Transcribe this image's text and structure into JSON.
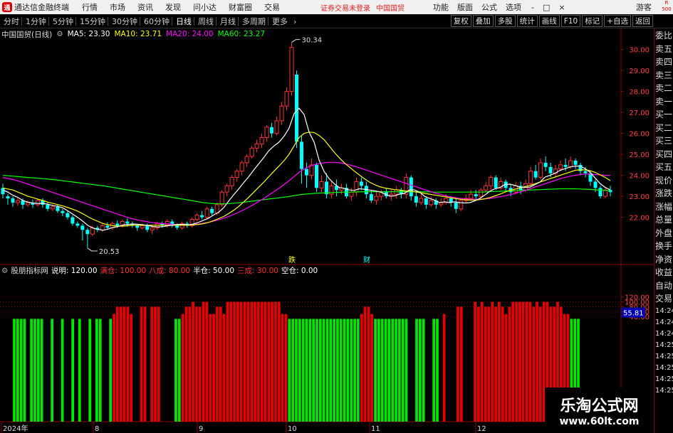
{
  "titlebar": {
    "app_name": "通达信金融终端",
    "menus": [
      "行情",
      "市场",
      "资讯",
      "发现",
      "问小达",
      "财富圈",
      "交易"
    ],
    "alert": "证券交易未登录",
    "stock": "中国国贸",
    "right_menus": [
      "功能",
      "版面",
      "公式",
      "选项"
    ],
    "window_controls": [
      "-",
      "□",
      "×"
    ],
    "user": "游客",
    "badge": "R 500"
  },
  "periodbar": {
    "periods": [
      "分时",
      "1分钟",
      "5分钟",
      "15分钟",
      "30分钟",
      "60分钟",
      "日线",
      "周线",
      "月线",
      "多周期",
      "更多"
    ],
    "active": "日线",
    "tools": [
      "复权",
      "叠加",
      "多股",
      "统计",
      "画线",
      "F10",
      "标记",
      "+自选",
      "返回"
    ]
  },
  "main_chart": {
    "name": "中国国贸(日线)",
    "ma5": "MA5: 23.30",
    "ma10": "MA10: 23.71",
    "ma20": "MA20: 24.00",
    "ma60": "MA60: 23.27",
    "y_labels": [
      "30.00",
      "29.00",
      "28.00",
      "27.00",
      "26.00",
      "25.00",
      "24.00",
      "23.00",
      "22.00"
    ],
    "high_label": "30.34",
    "low_label": "20.53",
    "event_labels": [
      "跌",
      "财"
    ]
  },
  "sub_chart": {
    "name": "股朋指标网",
    "desc_label": "说明: 120.00",
    "full": "满仓: 100.00",
    "eighty": "八成: 80.00",
    "half": "半仓: 50.00",
    "thirty": "三成: 30.00",
    "empty": "空仓: 0.00",
    "y_labels": [
      "120.00",
      "100.00",
      "80.00",
      "60.00",
      "40.00"
    ],
    "current_value": "55.81"
  },
  "x_axis": {
    "labels": [
      "2024年",
      "8",
      "9",
      "10",
      "11",
      "12"
    ]
  },
  "right_panel": {
    "items": [
      "委比",
      "卖五",
      "卖四",
      "卖三",
      "卖二",
      "卖一",
      "买一",
      "买二",
      "买三",
      "买四",
      "买五",
      "现价",
      "涨跌",
      "涨幅",
      "总量",
      "外盘",
      "换手",
      "净资",
      "收益"
    ],
    "auto": "自动",
    "trade": "交易",
    "times": [
      "14:24",
      "14:24",
      "14:24",
      "14:25",
      "14:25",
      "14:25",
      "14:25",
      "14:25"
    ]
  },
  "watermark": {
    "title": "乐淘公式网",
    "url": "www.60lt.com"
  },
  "colors": {
    "up": "#ff3232",
    "down": "#00ffff",
    "ma5": "#ffffff",
    "ma10": "#ffff00",
    "ma20": "#ff00ff",
    "ma60": "#00ff00",
    "bar_red": "#e60000",
    "bar_green": "#00e600"
  },
  "chart_data": {
    "type": "bar",
    "title": "股朋指标网",
    "candles": [
      [
        23.4,
        23.1,
        23.6,
        22.9
      ],
      [
        23.0,
        22.9,
        23.1,
        22.6
      ],
      [
        22.9,
        22.7,
        23.0,
        22.5
      ],
      [
        22.7,
        22.8,
        22.95,
        22.55
      ],
      [
        22.8,
        22.6,
        22.9,
        22.4
      ],
      [
        22.6,
        22.7,
        22.8,
        22.5
      ],
      [
        22.7,
        22.6,
        22.85,
        22.45
      ],
      [
        22.6,
        22.8,
        22.9,
        22.5
      ],
      [
        22.8,
        22.6,
        22.9,
        22.45
      ],
      [
        22.6,
        22.4,
        22.7,
        22.3
      ],
      [
        22.4,
        22.5,
        22.6,
        22.3
      ],
      [
        22.5,
        22.3,
        22.6,
        22.2
      ],
      [
        22.3,
        22.2,
        22.4,
        22.05
      ],
      [
        22.2,
        22.0,
        22.3,
        21.9
      ],
      [
        22.0,
        21.7,
        22.1,
        21.6
      ],
      [
        21.7,
        21.6,
        21.8,
        21.5
      ],
      [
        21.6,
        21.4,
        21.7,
        20.9
      ],
      [
        21.4,
        21.2,
        21.5,
        20.53
      ],
      [
        21.2,
        21.5,
        21.6,
        21.1
      ],
      [
        21.5,
        21.4,
        21.6,
        21.3
      ],
      [
        21.4,
        21.6,
        21.7,
        21.3
      ],
      [
        21.6,
        21.5,
        21.75,
        21.4
      ],
      [
        21.5,
        21.7,
        21.8,
        21.4
      ],
      [
        21.7,
        21.6,
        21.85,
        21.5
      ],
      [
        21.6,
        21.8,
        21.9,
        21.5
      ],
      [
        21.8,
        21.7,
        21.95,
        21.55
      ],
      [
        21.7,
        21.6,
        21.8,
        21.5
      ],
      [
        21.6,
        21.5,
        21.7,
        21.35
      ],
      [
        21.5,
        21.6,
        21.7,
        21.4
      ],
      [
        21.6,
        21.4,
        21.7,
        21.3
      ],
      [
        21.4,
        21.5,
        21.6,
        21.2
      ],
      [
        21.5,
        21.7,
        21.8,
        21.4
      ],
      [
        21.7,
        21.6,
        21.8,
        21.5
      ],
      [
        21.6,
        21.8,
        21.9,
        21.5
      ],
      [
        21.8,
        21.6,
        21.9,
        21.5
      ],
      [
        21.6,
        21.5,
        21.7,
        21.4
      ],
      [
        21.5,
        21.7,
        21.8,
        21.4
      ],
      [
        21.7,
        21.6,
        21.8,
        21.5
      ],
      [
        21.6,
        21.9,
        22.0,
        21.5
      ],
      [
        21.9,
        22.1,
        22.2,
        21.8
      ],
      [
        22.1,
        22.0,
        22.3,
        21.9
      ],
      [
        22.0,
        22.4,
        22.5,
        21.9
      ],
      [
        22.4,
        22.2,
        22.5,
        22.1
      ],
      [
        22.2,
        22.6,
        22.7,
        22.1
      ],
      [
        22.6,
        23.2,
        23.3,
        22.5
      ],
      [
        23.2,
        23.5,
        23.6,
        23.0
      ],
      [
        23.5,
        23.9,
        24.0,
        23.3
      ],
      [
        23.9,
        24.2,
        24.3,
        23.7
      ],
      [
        24.2,
        24.6,
        24.7,
        24.0
      ],
      [
        24.6,
        24.9,
        25.0,
        24.4
      ],
      [
        24.9,
        25.3,
        25.4,
        24.8
      ],
      [
        25.3,
        25.5,
        25.7,
        25.1
      ],
      [
        25.5,
        25.8,
        26.0,
        25.3
      ],
      [
        25.8,
        26.3,
        26.4,
        25.6
      ],
      [
        26.3,
        26.0,
        26.5,
        25.8
      ],
      [
        26.0,
        26.6,
        26.8,
        25.9
      ],
      [
        26.6,
        27.3,
        27.5,
        26.4
      ],
      [
        27.3,
        28.0,
        28.2,
        27.1
      ],
      [
        28.0,
        30.1,
        30.34,
        27.8
      ],
      [
        28.8,
        25.6,
        29.0,
        25.3
      ],
      [
        25.6,
        24.3,
        25.9,
        23.6
      ],
      [
        24.3,
        24.0,
        24.6,
        23.4
      ],
      [
        24.0,
        24.5,
        24.8,
        23.8
      ],
      [
        24.5,
        23.4,
        24.6,
        23.2
      ],
      [
        23.4,
        23.7,
        24.0,
        23.2
      ],
      [
        23.7,
        23.1,
        24.1,
        22.9
      ],
      [
        23.1,
        23.5,
        23.7,
        22.9
      ],
      [
        23.5,
        23.3,
        23.8,
        23.0
      ],
      [
        23.3,
        23.4,
        23.6,
        23.1
      ],
      [
        23.4,
        23.0,
        23.6,
        22.9
      ],
      [
        23.0,
        23.2,
        23.4,
        22.8
      ],
      [
        23.2,
        23.7,
        23.9,
        23.0
      ],
      [
        23.7,
        23.5,
        23.9,
        23.3
      ],
      [
        23.5,
        23.1,
        23.7,
        22.9
      ],
      [
        23.1,
        22.8,
        23.3,
        22.7
      ],
      [
        22.8,
        23.0,
        23.2,
        22.6
      ],
      [
        23.0,
        23.2,
        23.3,
        22.8
      ],
      [
        23.2,
        23.0,
        23.4,
        22.9
      ],
      [
        23.0,
        23.1,
        23.3,
        22.8
      ],
      [
        23.1,
        23.3,
        23.5,
        22.9
      ],
      [
        23.3,
        23.1,
        23.4,
        22.9
      ],
      [
        23.1,
        23.9,
        24.1,
        22.9
      ],
      [
        23.9,
        23.0,
        24.0,
        22.8
      ],
      [
        23.0,
        22.7,
        23.2,
        22.5
      ],
      [
        22.7,
        22.9,
        23.1,
        22.6
      ],
      [
        22.9,
        22.6,
        23.0,
        22.4
      ],
      [
        22.6,
        22.8,
        23.0,
        22.5
      ],
      [
        22.8,
        22.6,
        22.9,
        22.4
      ],
      [
        22.6,
        22.7,
        22.9,
        22.5
      ],
      [
        22.7,
        22.9,
        23.1,
        22.6
      ],
      [
        22.9,
        22.7,
        23.0,
        22.5
      ],
      [
        22.7,
        22.4,
        22.9,
        22.2
      ],
      [
        22.4,
        22.8,
        22.9,
        22.3
      ],
      [
        22.8,
        22.9,
        23.1,
        22.7
      ],
      [
        22.9,
        23.1,
        23.3,
        22.8
      ],
      [
        23.1,
        23.0,
        23.3,
        22.8
      ],
      [
        23.0,
        23.3,
        23.4,
        22.9
      ],
      [
        23.3,
        23.5,
        23.7,
        23.2
      ],
      [
        23.5,
        23.9,
        24.0,
        23.3
      ],
      [
        23.9,
        23.4,
        24.0,
        23.3
      ],
      [
        23.4,
        23.7,
        23.9,
        23.3
      ],
      [
        23.7,
        23.4,
        23.8,
        23.2
      ],
      [
        23.4,
        23.2,
        23.6,
        23.0
      ],
      [
        23.2,
        23.5,
        23.7,
        23.1
      ],
      [
        23.5,
        23.3,
        23.7,
        23.1
      ],
      [
        23.3,
        23.6,
        23.8,
        23.2
      ],
      [
        23.6,
        24.2,
        24.4,
        23.5
      ],
      [
        24.2,
        23.9,
        24.5,
        23.8
      ],
      [
        23.9,
        24.6,
        24.8,
        23.8
      ],
      [
        24.6,
        24.4,
        24.9,
        24.2
      ],
      [
        24.4,
        24.1,
        24.6,
        23.9
      ],
      [
        24.1,
        24.3,
        24.5,
        23.9
      ],
      [
        24.3,
        24.5,
        24.7,
        24.2
      ],
      [
        24.5,
        24.4,
        24.8,
        24.2
      ],
      [
        24.4,
        24.7,
        24.9,
        24.3
      ],
      [
        24.7,
        24.5,
        24.8,
        24.3
      ],
      [
        24.5,
        24.2,
        24.6,
        24.0
      ],
      [
        24.2,
        24.1,
        24.4,
        23.9
      ],
      [
        24.1,
        23.7,
        24.2,
        23.5
      ],
      [
        23.7,
        23.4,
        23.8,
        23.2
      ],
      [
        23.4,
        23.0,
        23.5,
        22.9
      ],
      [
        23.0,
        23.3,
        23.4,
        22.9
      ],
      [
        23.3,
        23.2,
        23.5,
        23.0
      ]
    ],
    "ma5": [
      23.3,
      23.2,
      23.05,
      22.95,
      22.8,
      22.72,
      22.68,
      22.66,
      22.66,
      22.62,
      22.56,
      22.52,
      22.44,
      22.3,
      22.14,
      21.98,
      21.8,
      21.6,
      21.48,
      21.42,
      21.38,
      21.44,
      21.52,
      21.56,
      21.64,
      21.66,
      21.68,
      21.66,
      21.64,
      21.6,
      21.56,
      21.54,
      21.56,
      21.6,
      21.64,
      21.66,
      21.66,
      21.64,
      21.68,
      21.76,
      21.86,
      21.96,
      22.12,
      22.24,
      22.46,
      22.78,
      23.08,
      23.36,
      23.66,
      23.94,
      24.26,
      24.56,
      24.86,
      25.18,
      25.4,
      25.58,
      25.86,
      26.24,
      26.94,
      27.2,
      26.9,
      26.06,
      25.58,
      24.72,
      24.18,
      23.84,
      23.6,
      23.42,
      23.38,
      23.3,
      23.28,
      23.36,
      23.34,
      23.3,
      23.26,
      23.22,
      23.12,
      23.02,
      23.02,
      23.1,
      23.14,
      23.3,
      23.3,
      23.2,
      23.0,
      22.9,
      22.82,
      22.7,
      22.74,
      22.7,
      22.74,
      22.7,
      22.68,
      22.7,
      22.78,
      22.9,
      23.06,
      23.24,
      23.36,
      23.42,
      23.56,
      23.58,
      23.52,
      23.44,
      23.42,
      23.44,
      23.56,
      23.68,
      23.92,
      24.0,
      24.1,
      24.24,
      24.32,
      24.4,
      24.44,
      24.44,
      24.32,
      24.14,
      23.86,
      23.6,
      23.42,
      23.3
    ],
    "ma10": [
      23.4,
      23.35,
      23.3,
      23.2,
      23.1,
      23.0,
      22.94,
      22.86,
      22.8,
      22.72,
      22.66,
      22.6,
      22.54,
      22.46,
      22.38,
      22.28,
      22.16,
      22.02,
      21.9,
      21.8,
      21.7,
      21.64,
      21.6,
      21.58,
      21.58,
      21.6,
      21.62,
      21.62,
      21.62,
      21.62,
      21.62,
      21.62,
      21.62,
      21.62,
      21.62,
      21.62,
      21.62,
      21.62,
      21.64,
      21.66,
      21.7,
      21.76,
      21.84,
      21.94,
      22.04,
      22.18,
      22.34,
      22.52,
      22.74,
      22.96,
      23.2,
      23.44,
      23.68,
      23.94,
      24.2,
      24.44,
      24.7,
      25.0,
      25.4,
      25.8,
      26.0,
      26.06,
      26.04,
      25.9,
      25.7,
      25.4,
      25.1,
      24.84,
      24.6,
      24.4,
      24.2,
      24.02,
      23.84,
      23.68,
      23.56,
      23.46,
      23.4,
      23.36,
      23.32,
      23.3,
      23.26,
      23.24,
      23.22,
      23.18,
      23.14,
      23.1,
      23.06,
      23.02,
      22.98,
      22.94,
      22.9,
      22.86,
      22.84,
      22.82,
      22.82,
      22.84,
      22.88,
      22.94,
      23.02,
      23.1,
      23.2,
      23.28,
      23.34,
      23.4,
      23.46,
      23.52,
      23.6,
      23.68,
      23.76,
      23.84,
      23.92,
      24.0,
      24.08,
      24.16,
      24.24,
      24.26,
      24.26,
      24.22,
      24.14,
      24.02,
      23.9,
      23.75
    ],
    "ma20": [
      23.9,
      23.85,
      23.8,
      23.74,
      23.66,
      23.58,
      23.5,
      23.42,
      23.34,
      23.26,
      23.18,
      23.1,
      23.02,
      22.94,
      22.86,
      22.78,
      22.7,
      22.62,
      22.54,
      22.46,
      22.38,
      22.3,
      22.22,
      22.14,
      22.06,
      21.98,
      21.92,
      21.86,
      21.82,
      21.78,
      21.74,
      21.72,
      21.7,
      21.68,
      21.66,
      21.64,
      21.64,
      21.64,
      21.66,
      21.68,
      21.72,
      21.76,
      21.82,
      21.88,
      21.96,
      22.04,
      22.14,
      22.24,
      22.36,
      22.48,
      22.62,
      22.76,
      22.9,
      23.06,
      23.22,
      23.38,
      23.56,
      23.74,
      23.94,
      24.14,
      24.3,
      24.42,
      24.5,
      24.56,
      24.6,
      24.62,
      24.62,
      24.6,
      24.56,
      24.5,
      24.44,
      24.36,
      24.28,
      24.2,
      24.12,
      24.04,
      23.96,
      23.88,
      23.8,
      23.72,
      23.64,
      23.56,
      23.48,
      23.4,
      23.32,
      23.24,
      23.16,
      23.1,
      23.04,
      22.98,
      22.94,
      22.9,
      22.88,
      22.86,
      22.86,
      22.86,
      22.88,
      22.9,
      22.94,
      22.98,
      23.02,
      23.08,
      23.14,
      23.2,
      23.28,
      23.36,
      23.44,
      23.52,
      23.6,
      23.68,
      23.76,
      23.84,
      23.9,
      23.96,
      24.0,
      24.04,
      24.06,
      24.06,
      24.04,
      24.02,
      24.0,
      24.0
    ],
    "ma60": [
      24.0,
      23.98,
      23.96,
      23.94,
      23.92,
      23.9,
      23.88,
      23.86,
      23.84,
      23.82,
      23.8,
      23.77,
      23.74,
      23.71,
      23.68,
      23.65,
      23.62,
      23.59,
      23.56,
      23.53,
      23.5,
      23.46,
      23.42,
      23.38,
      23.34,
      23.3,
      23.26,
      23.22,
      23.18,
      23.14,
      23.1,
      23.06,
      23.02,
      22.98,
      22.94,
      22.9,
      22.86,
      22.82,
      22.78,
      22.74,
      22.7,
      22.67,
      22.65,
      22.64,
      22.64,
      22.65,
      22.67,
      22.69,
      22.72,
      22.75,
      22.78,
      22.81,
      22.84,
      22.87,
      22.9,
      22.93,
      22.96,
      22.99,
      23.03,
      23.07,
      23.1,
      23.12,
      23.14,
      23.15,
      23.16,
      23.17,
      23.18,
      23.19,
      23.2,
      23.2,
      23.21,
      23.21,
      23.22,
      23.22,
      23.22,
      23.22,
      23.22,
      23.22,
      23.22,
      23.22,
      23.22,
      23.22,
      23.22,
      23.22,
      23.21,
      23.21,
      23.2,
      23.2,
      23.2,
      23.2,
      23.2,
      23.2,
      23.2,
      23.2,
      23.2,
      23.2,
      23.21,
      23.22,
      23.23,
      23.24,
      23.25,
      23.26,
      23.27,
      23.28,
      23.29,
      23.3,
      23.31,
      23.32,
      23.33,
      23.34,
      23.35,
      23.36,
      23.36,
      23.36,
      23.36,
      23.35,
      23.34,
      23.33,
      23.31,
      23.29,
      23.28,
      23.27
    ],
    "indicator": [
      30,
      30,
      30,
      30,
      0,
      30,
      30,
      30,
      30,
      0,
      0,
      30,
      0,
      0,
      30,
      0,
      0,
      30,
      0,
      30,
      0,
      0,
      30,
      0,
      30,
      30,
      0,
      0,
      30,
      50,
      80,
      80,
      80,
      80,
      50,
      0,
      0,
      80,
      80,
      0,
      80,
      80,
      80,
      0,
      0,
      0,
      0,
      30,
      30,
      50,
      80,
      80,
      100,
      80,
      80,
      100,
      100,
      50,
      50,
      80,
      80,
      50,
      100,
      100,
      100,
      100,
      100,
      100,
      100,
      100,
      100,
      100,
      100,
      100,
      100,
      100,
      100,
      100,
      50,
      50,
      30,
      30,
      30,
      30,
      30,
      30,
      30,
      30,
      30,
      30,
      30,
      30,
      30,
      30,
      30,
      30,
      30,
      30,
      30,
      30,
      30,
      50,
      80,
      80,
      50,
      30,
      30,
      30,
      30,
      30,
      30,
      30,
      30,
      30,
      30,
      0,
      0,
      30,
      30,
      30,
      0,
      0,
      30,
      30,
      0,
      50,
      0,
      0,
      0,
      80,
      80,
      0,
      0,
      0,
      100,
      80,
      100,
      80,
      80,
      100,
      80,
      100,
      80,
      50,
      80,
      100,
      100,
      100,
      100,
      100,
      100,
      80,
      100,
      80,
      100,
      100,
      80,
      80,
      100,
      80,
      50,
      50,
      30,
      30,
      30
    ]
  }
}
